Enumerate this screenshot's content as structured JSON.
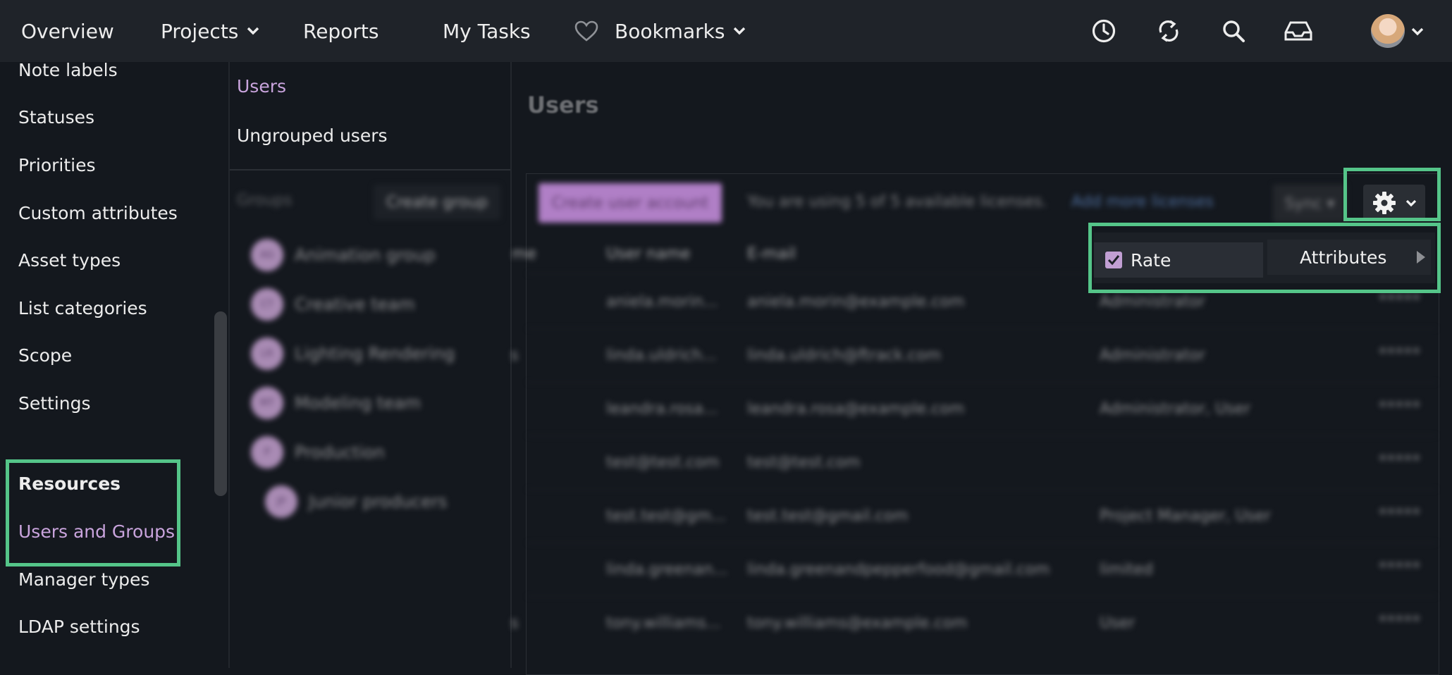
{
  "nav": {
    "overview": "Overview",
    "projects": "Projects",
    "reports": "Reports",
    "my_tasks": "My Tasks",
    "bookmarks": "Bookmarks",
    "icons": [
      "history-clock-icon",
      "sync-icon",
      "search-icon",
      "inbox-icon"
    ]
  },
  "sidebar": {
    "items": [
      {
        "label": "Note labels"
      },
      {
        "label": "Statuses"
      },
      {
        "label": "Priorities"
      },
      {
        "label": "Custom attributes"
      },
      {
        "label": "Asset types"
      },
      {
        "label": "List categories"
      },
      {
        "label": "Scope"
      },
      {
        "label": "Settings"
      }
    ],
    "resources_heading": "Resources",
    "active_item": "Users and Groups",
    "after_items": [
      {
        "label": "Manager types"
      },
      {
        "label": "LDAP settings"
      }
    ]
  },
  "users_nav": {
    "users": "Users",
    "ungrouped": "Ungrouped users",
    "groups_label": "Groups",
    "create_group": "Create group",
    "groups": [
      {
        "initials": "AG",
        "name": "Animation group"
      },
      {
        "initials": "CT",
        "name": "Creative team"
      },
      {
        "initials": "LR",
        "name": "Lighting Rendering"
      },
      {
        "initials": "MT",
        "name": "Modeling team"
      },
      {
        "initials": "P",
        "name": "Production"
      },
      {
        "initials": "JP",
        "name": "Junior producers"
      }
    ]
  },
  "main": {
    "title": "Users",
    "create_button": "Create user account",
    "license_text": "You are using 5 of 5 available licenses.",
    "add_licenses": "Add more licenses",
    "sync": "Sync",
    "columns": [
      "me",
      "User name",
      "E-mail"
    ],
    "rows": [
      {
        "prefix": "",
        "username": "aniela.morin...",
        "email": "aniela.morin@example.com",
        "roles": "Administrator",
        "password": "*****"
      },
      {
        "prefix": "s",
        "username": "linda.uldrich...",
        "email": "linda.uldrich@ftrack.com",
        "roles": "Administrator",
        "password": "*****"
      },
      {
        "prefix": "",
        "username": "leandra.rosa...",
        "email": "leandra.rosa@example.com",
        "roles": "Administrator, User",
        "password": "*****"
      },
      {
        "prefix": "",
        "username": "test@test.com",
        "email": "test@test.com",
        "roles": "",
        "password": "*****"
      },
      {
        "prefix": "",
        "username": "test.test@gm...",
        "email": "test.test@gmail.com",
        "roles": "Project Manager, User",
        "password": "*****"
      },
      {
        "prefix": "",
        "username": "linda.greenan...",
        "email": "linda.greenandpepperfood@gmail.com",
        "roles": "limited",
        "password": "*****"
      },
      {
        "prefix": "s",
        "username": "tony.williams...",
        "email": "tony.williams@example.com",
        "roles": "User",
        "password": "*****"
      }
    ]
  },
  "column_menu": {
    "rate": "Rate",
    "rate_checked": true,
    "attributes": "Attributes"
  },
  "colors": {
    "accent": "#c9a4dd",
    "highlight": "#55c589"
  }
}
